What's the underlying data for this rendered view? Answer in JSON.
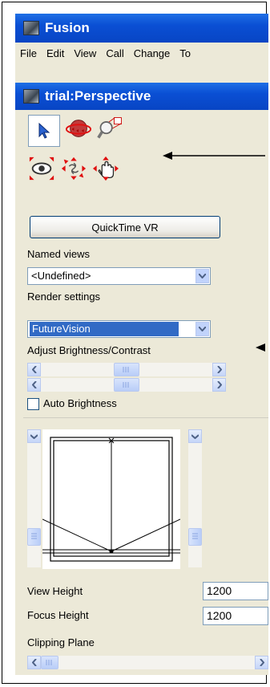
{
  "app": {
    "title": "Fusion"
  },
  "menu": [
    "File",
    "Edit",
    "View",
    "Call",
    "Change",
    "To"
  ],
  "panel": {
    "title": "trial:Perspective"
  },
  "tools": {
    "row1": [
      "pointer-arrow-icon",
      "orbit-icon",
      "zoom-window-icon"
    ],
    "row2": [
      "look-around-icon",
      "spin-icon",
      "pan-hand-icon"
    ]
  },
  "quicktime_button": "QuickTime VR",
  "named_views": {
    "label": "Named views",
    "value": "<Undefined>"
  },
  "render_settings": {
    "label": "Render settings",
    "value": "FutureVision"
  },
  "brightness": {
    "label": "Adjust Brightness/Contrast"
  },
  "auto_brightness": {
    "label": "Auto Brightness",
    "checked": false
  },
  "view_height": {
    "label": "View Height",
    "value": "1200"
  },
  "focus_height": {
    "label": "Focus Height",
    "value": "1200"
  },
  "clipping_plane": {
    "label": "Clipping Plane"
  },
  "colors": {
    "titlebar": "#0a4fd4",
    "panel_bg": "#ece9d8",
    "selection": "#316ac5",
    "handle_red": "#e01010"
  }
}
